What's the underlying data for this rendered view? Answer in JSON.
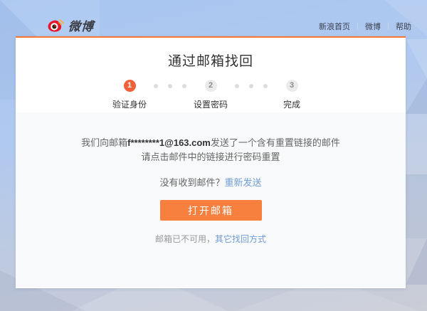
{
  "brand": {
    "logo_text": "微博"
  },
  "header_links": [
    {
      "label": "新浪首页"
    },
    {
      "label": "微博"
    },
    {
      "label": "帮助"
    }
  ],
  "card": {
    "title": "通过邮箱找回",
    "steps": [
      {
        "num": "1",
        "label": "验证身份",
        "active": true
      },
      {
        "num": "2",
        "label": "设置密码",
        "active": false
      },
      {
        "num": "3",
        "label": "完成",
        "active": false
      }
    ],
    "message": {
      "prefix": "我们向邮箱",
      "email": "f********1@163.com",
      "suffix": "发送了一个含有重置链接的邮件",
      "line2": "请点击邮件中的链接进行密码重置"
    },
    "resend": {
      "text": "没有收到邮件？",
      "link": "重新发送"
    },
    "open_mail_button": "打开邮箱",
    "fallback": {
      "text": "邮箱已不可用，",
      "link": "其它找回方式"
    }
  },
  "colors": {
    "accent": "#f7772e",
    "button": "#f8803f",
    "link": "#6f9cd4",
    "step_active": "#f0613b"
  }
}
